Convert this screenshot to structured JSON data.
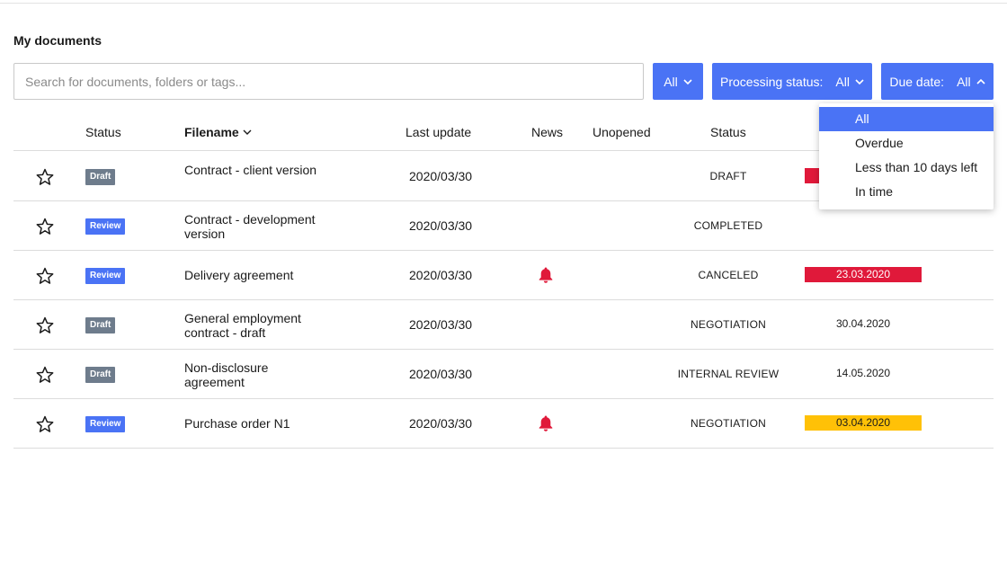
{
  "page_title": "My documents",
  "search": {
    "placeholder": "Search for documents, folders or tags..."
  },
  "filters": {
    "all": {
      "value": "All"
    },
    "processing": {
      "label": "Processing status:",
      "value": "All"
    },
    "due": {
      "label": "Due date:",
      "value": "All"
    }
  },
  "columns": {
    "status": "Status",
    "filename": "Filename",
    "last_update": "Last update",
    "news": "News",
    "unopened": "Unopened",
    "processing_status": "Status"
  },
  "rows": [
    {
      "badge": "Draft",
      "badge_type": "draft",
      "filename": "Contract - client version",
      "last_update": "2020/03/30",
      "news": false,
      "status": "DRAFT",
      "due_date": "",
      "due_color": "red"
    },
    {
      "badge": "Review",
      "badge_type": "review",
      "filename": "Contract - development version",
      "last_update": "2020/03/30",
      "news": false,
      "status": "COMPLETED",
      "due_date": "",
      "due_color": "none"
    },
    {
      "badge": "Review",
      "badge_type": "review",
      "filename": "Delivery agreement",
      "last_update": "2020/03/30",
      "news": true,
      "status": "CANCELED",
      "due_date": "23.03.2020",
      "due_color": "red"
    },
    {
      "badge": "Draft",
      "badge_type": "draft",
      "filename": "General employment contract - draft",
      "last_update": "2020/03/30",
      "news": false,
      "status": "NEGOTIATION",
      "due_date": "30.04.2020",
      "due_color": "none"
    },
    {
      "badge": "Draft",
      "badge_type": "draft",
      "filename": "Non-disclosure agreement",
      "last_update": "2020/03/30",
      "news": false,
      "status": "INTERNAL REVIEW",
      "due_date": "14.05.2020",
      "due_color": "none"
    },
    {
      "badge": "Review",
      "badge_type": "review",
      "filename": "Purchase order N1",
      "last_update": "2020/03/30",
      "news": true,
      "status": "NEGOTIATION",
      "due_date": "03.04.2020",
      "due_color": "yellow"
    }
  ],
  "due_dropdown": {
    "options": [
      "All",
      "Overdue",
      "Less than 10 days left",
      "In time"
    ],
    "selected": "All"
  },
  "colors": {
    "accent": "#4a73f5",
    "draft_badge": "#6e7c8c",
    "overdue": "#e0193a",
    "warning": "#ffc107",
    "bell": "#e0193a"
  },
  "icons": {
    "favorite": "star-outline-icon",
    "news": "bell-icon",
    "dropdown": "chevron-down-icon",
    "dropdown_open": "chevron-up-icon",
    "sort": "chevron-down-icon"
  }
}
